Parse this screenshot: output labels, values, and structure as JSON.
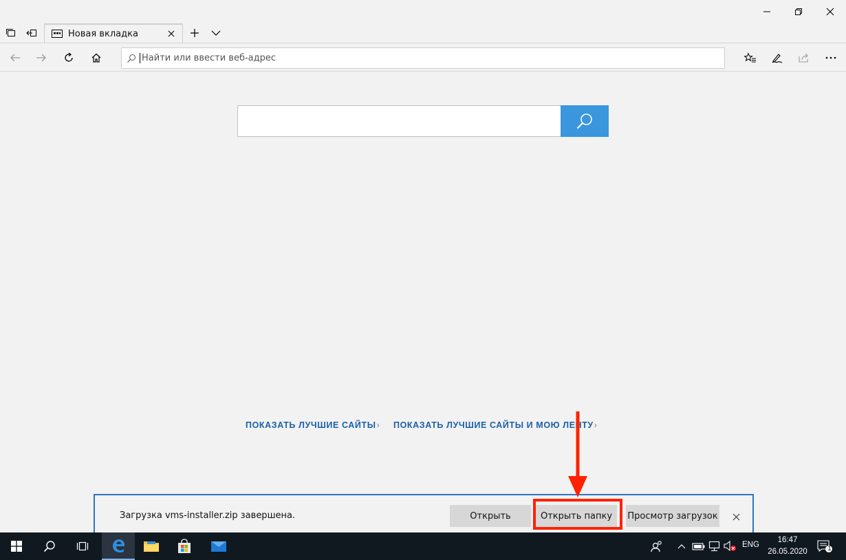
{
  "tab": {
    "title": "Новая вкладка"
  },
  "address": {
    "placeholder": "Найти или ввести веб-адрес"
  },
  "links": {
    "top_sites": "ПОКАЗАТЬ ЛУЧШИЕ САЙТЫ",
    "top_sites_feed": "ПОКАЗАТЬ ЛУЧШИЕ САЙТЫ И МОЮ ЛЕНТУ",
    "chevron": "›"
  },
  "download": {
    "message": "Загрузка vms-installer.zip завершена.",
    "open_label": "Открыть",
    "open_folder_label": "Открыть папку",
    "view_downloads_label": "Просмотр загрузок"
  },
  "tray": {
    "language": "ENG",
    "time": "16:47",
    "date": "26.05.2020",
    "notifications_count": "1"
  },
  "colors": {
    "accent": "#3a96dd",
    "download_border": "#2e74c0",
    "link": "#1a5fa8",
    "annotation": "#ff2200",
    "taskbar": "#101820"
  },
  "icons": {
    "minimize": "minimize-icon",
    "maximize": "restore-icon",
    "close": "close-icon",
    "tabs_aside": "tabs-aside-icon",
    "back": "back-arrow-icon",
    "forward": "forward-arrow-icon",
    "refresh": "refresh-icon",
    "home": "home-icon",
    "favorites": "favorites-icon",
    "notes": "pen-icon",
    "share": "share-icon",
    "more": "more-icon"
  }
}
